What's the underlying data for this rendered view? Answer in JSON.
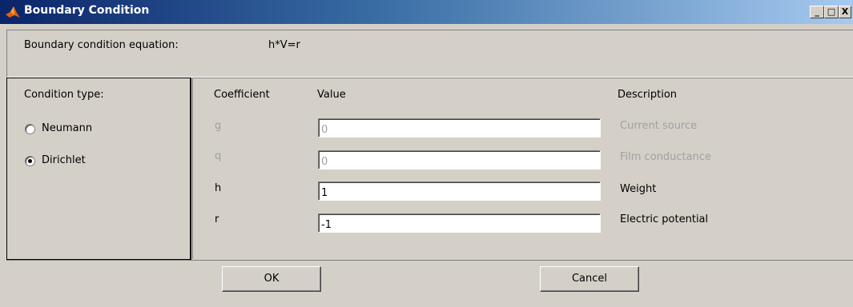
{
  "window": {
    "title": "Boundary Condition",
    "min": "_",
    "max": "□",
    "close": "X"
  },
  "equation": {
    "label": "Boundary condition equation:",
    "value": "h*V=r"
  },
  "condition": {
    "label": "Condition type:",
    "options": [
      {
        "label": "Neumann",
        "selected": false
      },
      {
        "label": "Dirichlet",
        "selected": true
      }
    ]
  },
  "table": {
    "headers": {
      "coefficient": "Coefficient",
      "value": "Value",
      "description": "Description"
    },
    "rows": [
      {
        "coef": "g",
        "value": "0",
        "desc": "Current source",
        "enabled": false
      },
      {
        "coef": "q",
        "value": "0",
        "desc": "Film conductance",
        "enabled": false
      },
      {
        "coef": "h",
        "value": "1",
        "desc": "Weight",
        "enabled": true
      },
      {
        "coef": "r",
        "value": "-1",
        "desc": "Electric potential",
        "enabled": true
      }
    ]
  },
  "buttons": {
    "ok": "OK",
    "cancel": "Cancel"
  }
}
